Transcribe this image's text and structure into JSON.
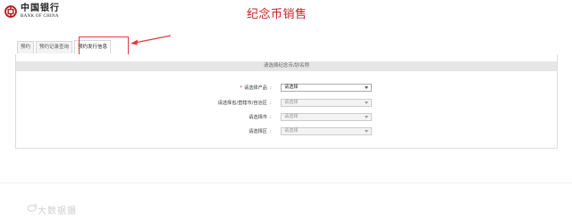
{
  "header": {
    "logo_cn": "中国银行",
    "logo_en": "BANK OF CHINA",
    "title": "纪念币销售"
  },
  "tabs": [
    {
      "label": "预约"
    },
    {
      "label": "预约记录查询"
    },
    {
      "label": "预约发行信息",
      "active": true
    }
  ],
  "panel": {
    "heading": "请选择纪念币/钞名称"
  },
  "form": {
    "colon": ":",
    "rows": [
      {
        "label": "请选择产品",
        "required_mark": "*",
        "value": "请选择",
        "disabled": false
      },
      {
        "label": "请选择省/直辖市/自治区",
        "value": "请选择",
        "disabled": true
      },
      {
        "label": "请选择市",
        "value": "请选择",
        "disabled": true
      },
      {
        "label": "请选择区",
        "value": "请选择",
        "disabled": true
      }
    ]
  },
  "watermark": {
    "text": "大数据摄"
  },
  "colors": {
    "brand_red": "#cc1f27",
    "highlight_red": "#e23a3a"
  }
}
